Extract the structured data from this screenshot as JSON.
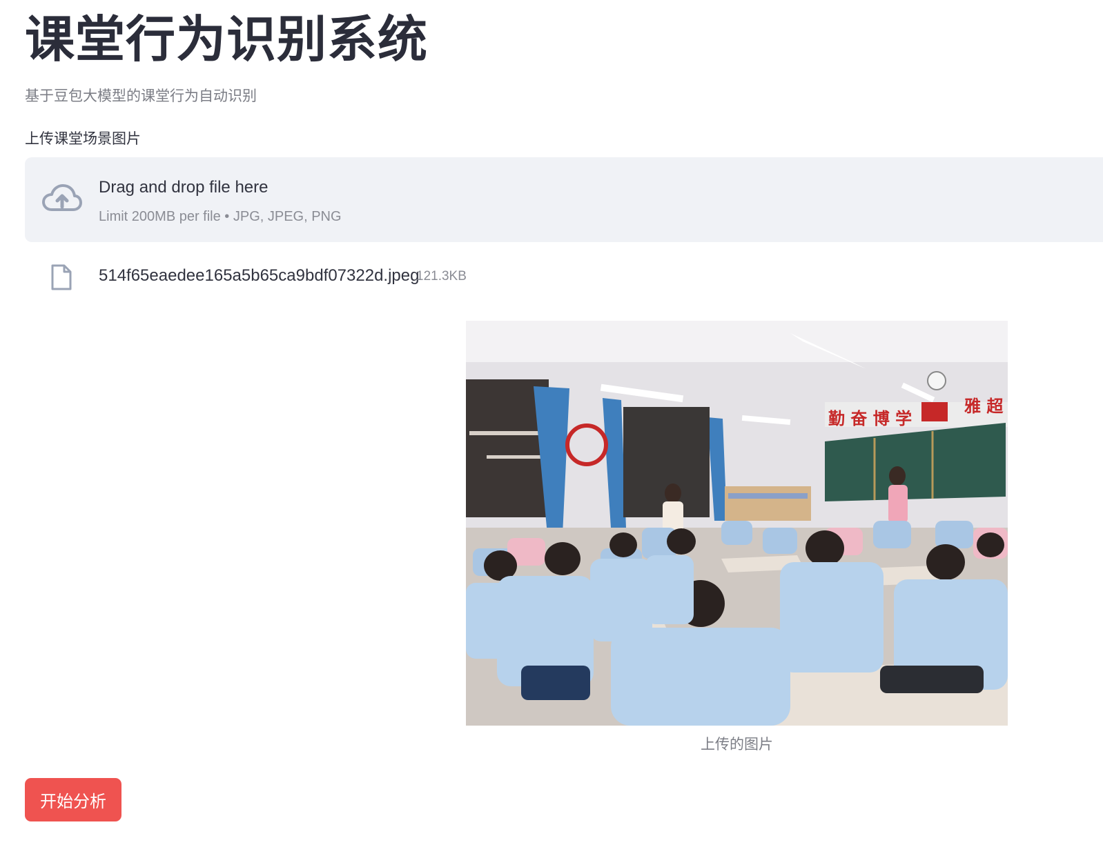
{
  "header": {
    "title": "课堂行为识别系统",
    "subtitle": "基于豆包大模型的课堂行为自动识别"
  },
  "uploader": {
    "label": "上传课堂场景图片",
    "drop_text": "Drag and drop file here",
    "limit_text": "Limit 200MB per file • JPG, JPEG, PNG",
    "icon": "cloud-upload-icon"
  },
  "uploaded_file": {
    "name": "514f65eaedee165a5b65ca9bdf07322d.jpeg",
    "size": "121.3KB",
    "icon": "file-icon"
  },
  "preview": {
    "banner_text": "勤 奋 博 学",
    "banner_text_right": "雅 超",
    "caption": "上传的图片"
  },
  "actions": {
    "analyze_label": "开始分析"
  },
  "colors": {
    "primary_button": "#ef5350",
    "dropzone_bg": "#f0f2f6",
    "text": "#31333f",
    "muted_text": "#7b7d85"
  }
}
